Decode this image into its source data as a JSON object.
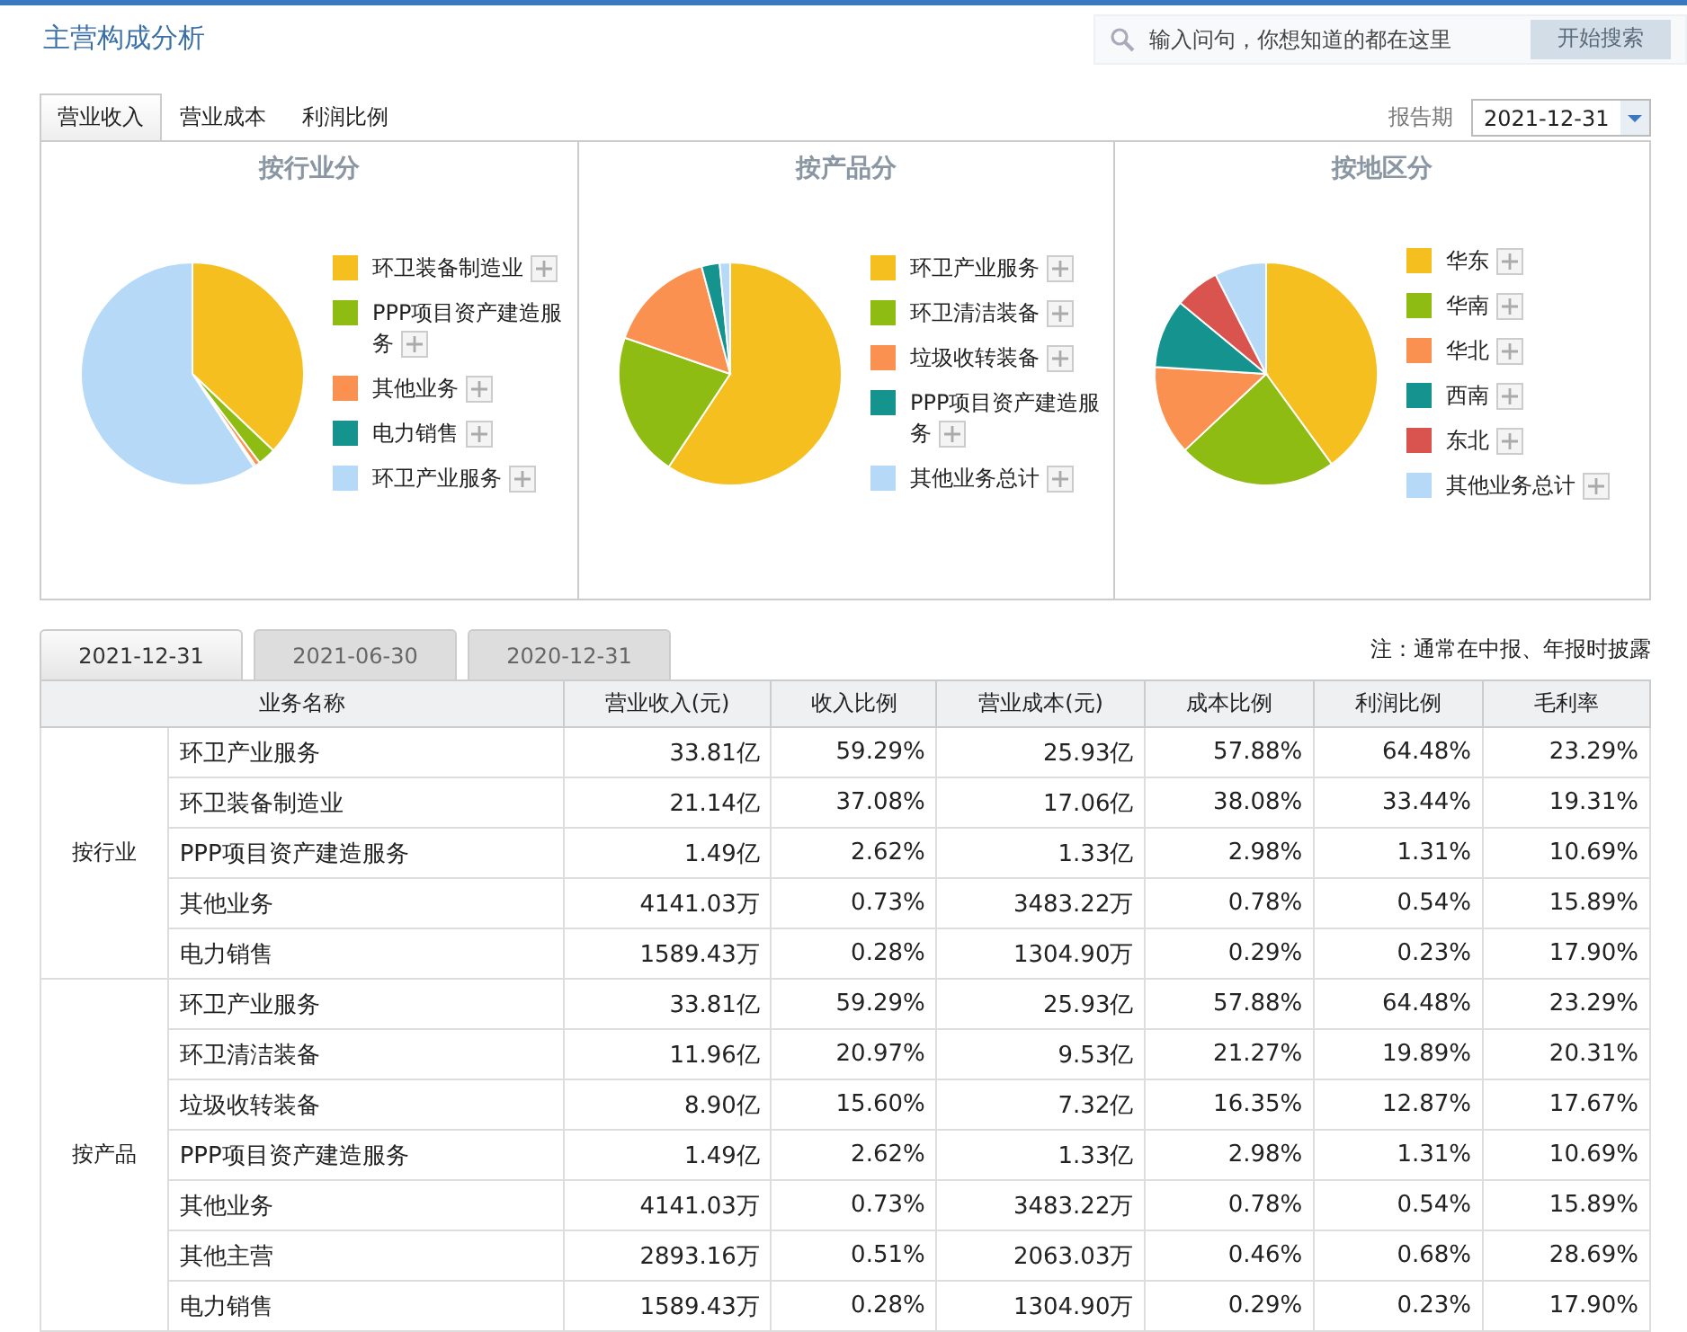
{
  "title": "主营构成分析",
  "search": {
    "placeholder": "输入问句，你想知道的都在这里",
    "button": "开始搜索"
  },
  "tabs": [
    {
      "label": "营业收入",
      "selected": true
    },
    {
      "label": "营业成本",
      "selected": false
    },
    {
      "label": "利润比例",
      "selected": false
    }
  ],
  "report_period": {
    "label": "报告期",
    "value": "2021-12-31"
  },
  "charts": [
    {
      "title": "按行业分",
      "legend": [
        {
          "label": "环卫装备制造业",
          "color": "#f5bf1f"
        },
        {
          "label": "PPP项目资产建造服务",
          "color": "#8fbc12"
        },
        {
          "label": "其他业务",
          "color": "#fb9150"
        },
        {
          "label": "电力销售",
          "color": "#15938f"
        },
        {
          "label": "环卫产业服务",
          "color": "#b5d9f7"
        }
      ]
    },
    {
      "title": "按产品分",
      "legend": [
        {
          "label": "环卫产业服务",
          "color": "#f5bf1f"
        },
        {
          "label": "环卫清洁装备",
          "color": "#8fbc12"
        },
        {
          "label": "垃圾收转装备",
          "color": "#fb9150"
        },
        {
          "label": "PPP项目资产建造服务",
          "color": "#15938f"
        },
        {
          "label": "其他业务总计",
          "color": "#b5d9f7"
        }
      ]
    },
    {
      "title": "按地区分",
      "legend": [
        {
          "label": "华东",
          "color": "#f5bf1f"
        },
        {
          "label": "华南",
          "color": "#8fbc12"
        },
        {
          "label": "华北",
          "color": "#fb9150"
        },
        {
          "label": "西南",
          "color": "#15938f"
        },
        {
          "label": "东北",
          "color": "#d9534f"
        },
        {
          "label": "其他业务总计",
          "color": "#b5d9f7"
        }
      ]
    }
  ],
  "date_tabs": [
    {
      "label": "2021-12-31",
      "selected": true
    },
    {
      "label": "2021-06-30",
      "selected": false
    },
    {
      "label": "2020-12-31",
      "selected": false
    }
  ],
  "note": "注：通常在中报、年报时披露",
  "table": {
    "columns": [
      "业务名称",
      "营业收入(元)",
      "收入比例",
      "营业成本(元)",
      "成本比例",
      "利润比例",
      "毛利率"
    ],
    "groups": [
      {
        "name": "按行业",
        "rows": [
          [
            "环卫产业服务",
            "33.81亿",
            "59.29%",
            "25.93亿",
            "57.88%",
            "64.48%",
            "23.29%"
          ],
          [
            "环卫装备制造业",
            "21.14亿",
            "37.08%",
            "17.06亿",
            "38.08%",
            "33.44%",
            "19.31%"
          ],
          [
            "PPP项目资产建造服务",
            "1.49亿",
            "2.62%",
            "1.33亿",
            "2.98%",
            "1.31%",
            "10.69%"
          ],
          [
            "其他业务",
            "4141.03万",
            "0.73%",
            "3483.22万",
            "0.78%",
            "0.54%",
            "15.89%"
          ],
          [
            "电力销售",
            "1589.43万",
            "0.28%",
            "1304.90万",
            "0.29%",
            "0.23%",
            "17.90%"
          ]
        ]
      },
      {
        "name": "按产品",
        "rows": [
          [
            "环卫产业服务",
            "33.81亿",
            "59.29%",
            "25.93亿",
            "57.88%",
            "64.48%",
            "23.29%"
          ],
          [
            "环卫清洁装备",
            "11.96亿",
            "20.97%",
            "9.53亿",
            "21.27%",
            "19.89%",
            "20.31%"
          ],
          [
            "垃圾收转装备",
            "8.90亿",
            "15.60%",
            "7.32亿",
            "16.35%",
            "12.87%",
            "17.67%"
          ],
          [
            "PPP项目资产建造服务",
            "1.49亿",
            "2.62%",
            "1.33亿",
            "2.98%",
            "1.31%",
            "10.69%"
          ],
          [
            "其他业务",
            "4141.03万",
            "0.73%",
            "3483.22万",
            "0.78%",
            "0.54%",
            "15.89%"
          ],
          [
            "其他主营",
            "2893.16万",
            "0.51%",
            "2063.03万",
            "0.46%",
            "0.68%",
            "28.69%"
          ],
          [
            "电力销售",
            "1589.43万",
            "0.28%",
            "1304.90万",
            "0.29%",
            "0.23%",
            "17.90%"
          ]
        ]
      }
    ]
  }
}
